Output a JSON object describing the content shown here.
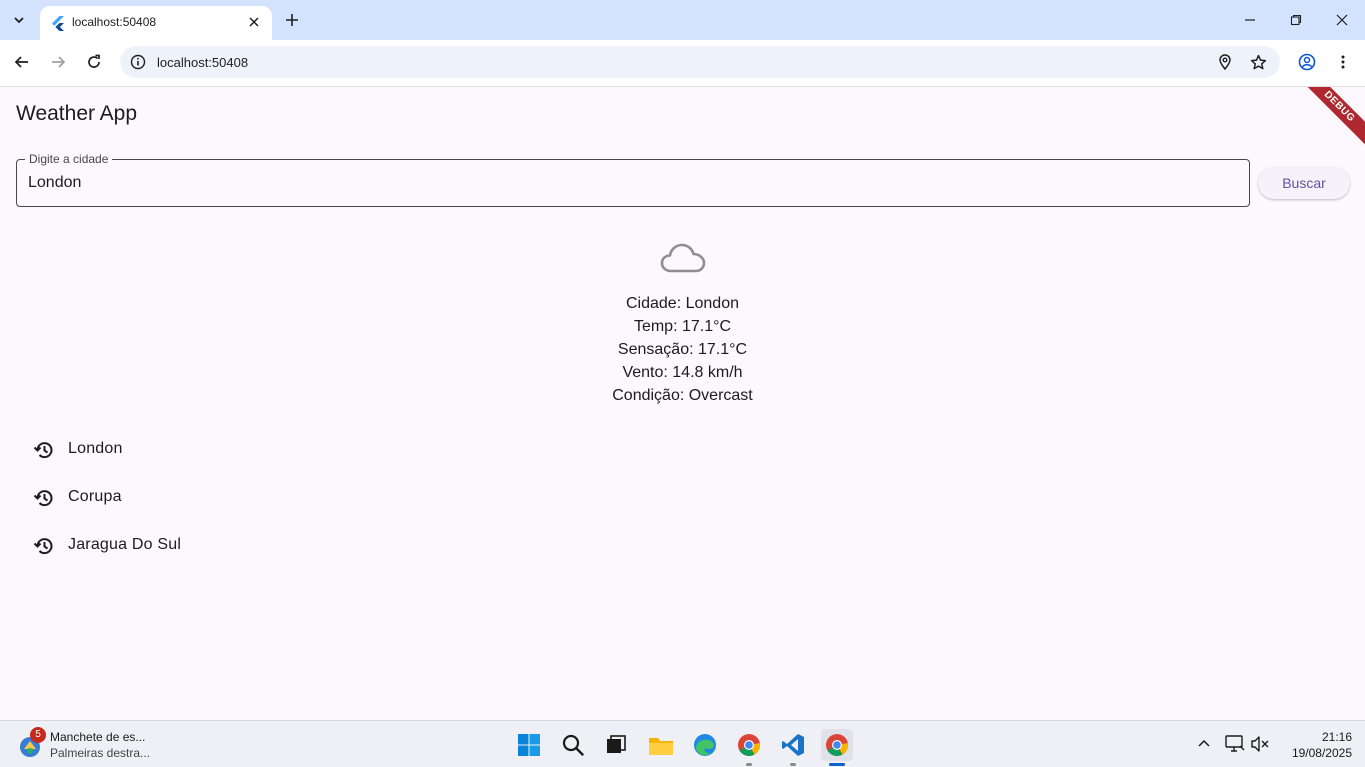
{
  "browser": {
    "tab_title": "localhost:50408",
    "url": "localhost:50408"
  },
  "app": {
    "title": "Weather App",
    "debug_banner": "DEBUG",
    "search": {
      "label": "Digite a cidade",
      "value": "London",
      "button_label": "Buscar"
    },
    "weather": {
      "icon": "cloud-icon",
      "lines": [
        "Cidade: London",
        "Temp: 17.1°C",
        "Sensação: 17.1°C",
        "Vento: 14.8 km/h",
        "Condição: Overcast"
      ]
    },
    "history": [
      {
        "label": "London",
        "icon": "history-icon"
      },
      {
        "label": "Corupa",
        "icon": "history-icon"
      },
      {
        "label": "Jaragua Do Sul",
        "icon": "history-icon"
      }
    ]
  },
  "taskbar": {
    "news": {
      "badge": "5",
      "headline": "Manchete de es...",
      "subtitle": "Palmeiras destra..."
    },
    "clock": {
      "time": "21:16",
      "date": "19/08/2025"
    }
  },
  "colors": {
    "accent": "#6750a4",
    "app_background": "#fdf7fe",
    "browser_frame": "#d3e3fd",
    "debug_banner": "#b0282f"
  }
}
